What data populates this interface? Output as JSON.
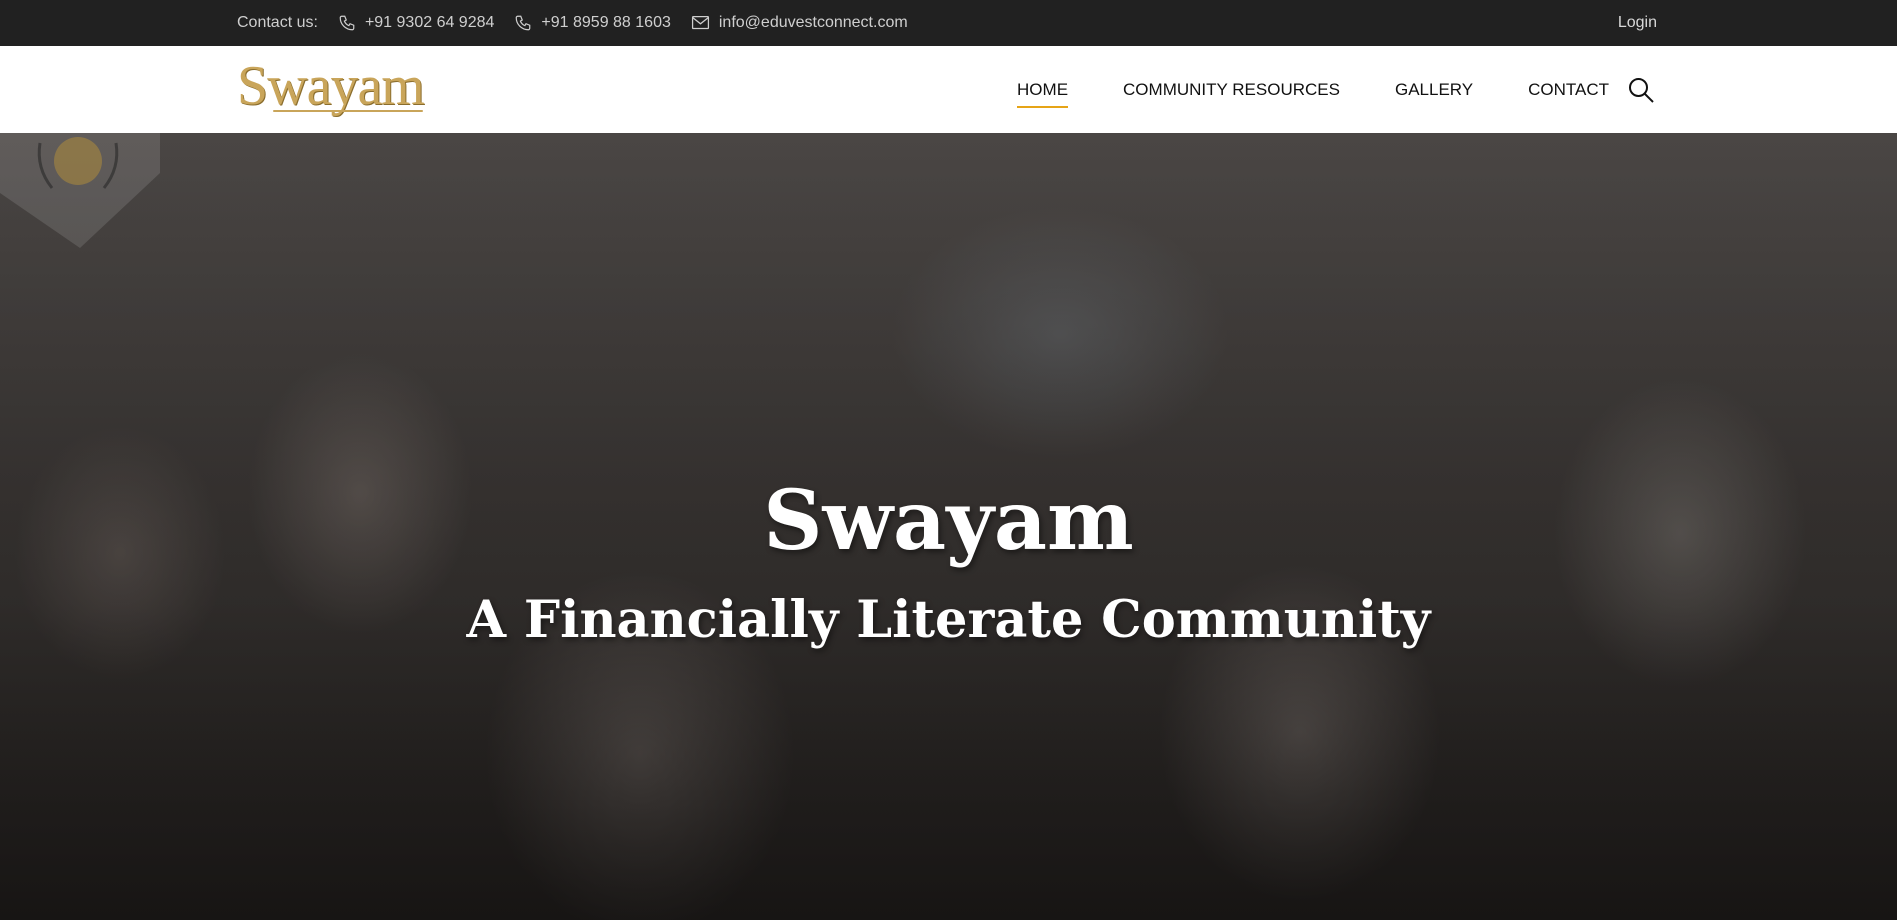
{
  "topbar": {
    "contact_label": "Contact us:",
    "phone_1": "+91 9302 64 9284",
    "phone_2": "+91 8959 88 1603",
    "email": "info@eduvestconnect.com",
    "login_label": "Login",
    "icons": [
      "phone-icon",
      "phone-icon",
      "mail-icon"
    ]
  },
  "header": {
    "logo_text": "Swayam",
    "nav": [
      {
        "label": "HOME",
        "active": true
      },
      {
        "label": "COMMUNITY RESOURCES",
        "active": false
      },
      {
        "label": "GALLERY",
        "active": false
      },
      {
        "label": "CONTACT",
        "active": false
      }
    ],
    "search_icon": "search-icon"
  },
  "hero": {
    "title": "Swayam",
    "subtitle": "A Financially Literate Community",
    "background": "photo of students in a classroom",
    "badge_icon": "crest-badge-icon"
  },
  "colors": {
    "topbar_bg": "#212121",
    "header_bg": "#ffffff",
    "logo_gold": "#c9a55a",
    "active_underline": "#e6a417",
    "hero_text": "#ffffff"
  }
}
